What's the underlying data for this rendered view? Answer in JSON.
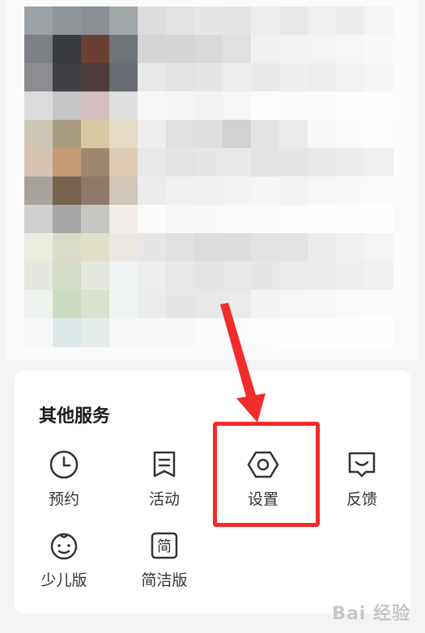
{
  "services": {
    "title": "其他服务",
    "items": [
      {
        "label": "预约",
        "icon": "clock-icon"
      },
      {
        "label": "活动",
        "icon": "message-icon"
      },
      {
        "label": "设置",
        "icon": "hexagon-settings-icon"
      },
      {
        "label": "反馈",
        "icon": "feedback-icon"
      },
      {
        "label": "少儿版",
        "icon": "child-face-icon"
      },
      {
        "label": "简洁版",
        "icon": "simple-mode-icon"
      }
    ]
  },
  "annotation": {
    "highlight_color": "#f22b2b"
  },
  "watermark": {
    "text": "Bai 经验"
  }
}
